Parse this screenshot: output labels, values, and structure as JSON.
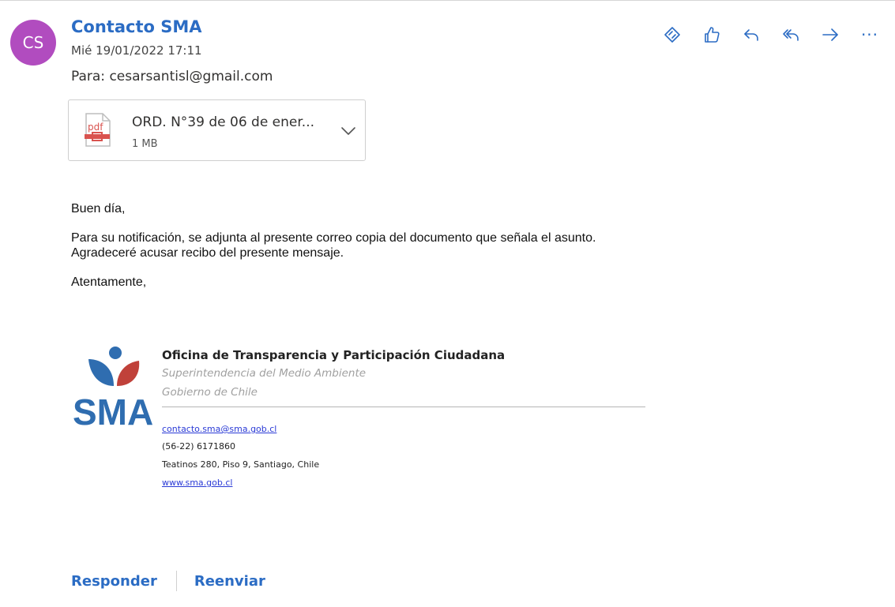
{
  "message": {
    "avatar_initials": "CS",
    "sender": "Contacto SMA",
    "date": "Mié 19/01/2022 17:11",
    "to_label": "Para:",
    "to_address": "cesarsantisl@gmail.com"
  },
  "toolbar": {
    "icons": [
      "immersive-reader-icon",
      "like-icon",
      "reply-icon",
      "reply-all-icon",
      "forward-icon",
      "more-icon"
    ],
    "more_label": "···"
  },
  "attachment": {
    "icon_text": "pdf",
    "name": "ORD. N°39 de 06 de ener...",
    "size": "1 MB"
  },
  "body": {
    "greeting": "Buen día,",
    "line1": "Para su notificación, se adjunta al presente correo copia del documento que señala el asunto.",
    "line2": "Agradeceré acusar recibo del presente mensaje.",
    "closing": "Atentamente,"
  },
  "signature": {
    "logo_text": "SMA",
    "title": "Oficina de Transparencia y Participación Ciudadana",
    "org": "Superintendencia del Medio Ambiente",
    "gov": "Gobierno de Chile",
    "email": "contacto.sma@sma.gob.cl",
    "phone": "(56-22) 6171860",
    "address": "Teatinos 280, Piso 9, Santiago, Chile",
    "website": "www.sma.gob.cl"
  },
  "footer": {
    "reply_label": "Responder",
    "forward_label": "Reenviar"
  },
  "colors": {
    "accent": "#2b6cc4",
    "avatar": "#b14cbf",
    "pdf_red": "#d9534f",
    "logo_blue": "#2f6db0",
    "logo_red": "#c0413a"
  }
}
